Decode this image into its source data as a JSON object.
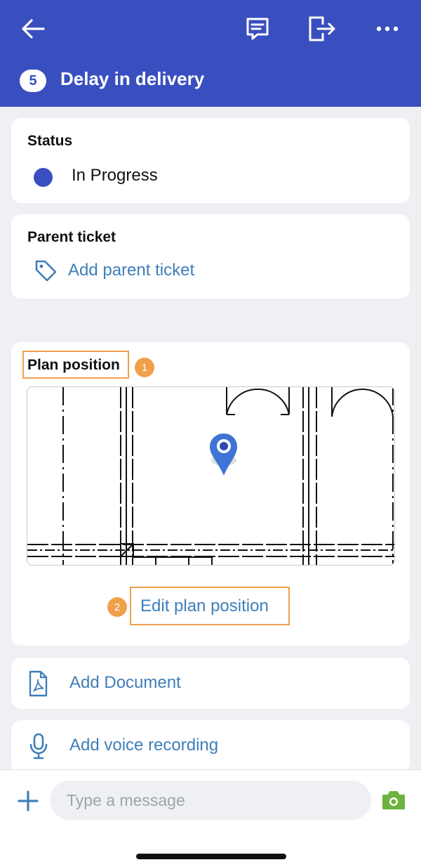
{
  "header": {
    "ticket_number": "5",
    "title": "Delay in delivery"
  },
  "status": {
    "label": "Status",
    "value": "In Progress",
    "color": "#3a4fbf"
  },
  "parent_ticket": {
    "label": "Parent ticket",
    "action": "Add parent ticket"
  },
  "plan_position": {
    "label": "Plan position",
    "badge_1": "1",
    "badge_2": "2",
    "edit_action": "Edit plan position"
  },
  "documents": {
    "add_document": "Add Document",
    "add_voice": "Add voice recording"
  },
  "composer": {
    "placeholder": "Type a message"
  },
  "colors": {
    "header_bg": "#3a4fbf",
    "link": "#3f7fb8",
    "highlight": "#f0a04b",
    "camera": "#6cb33f"
  }
}
